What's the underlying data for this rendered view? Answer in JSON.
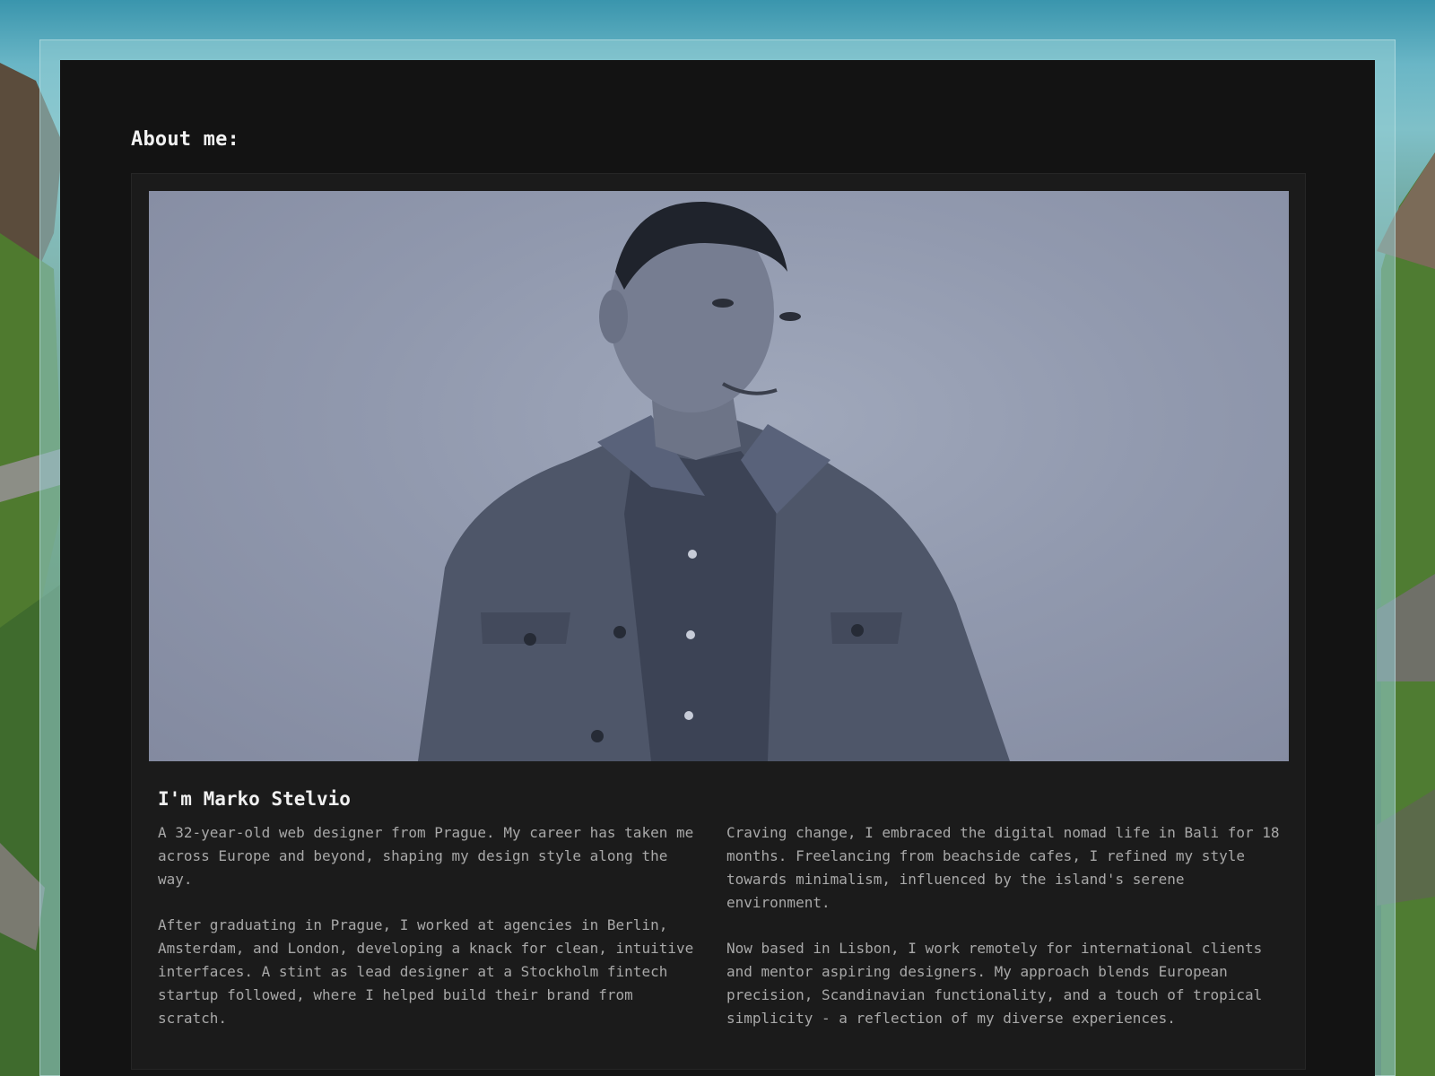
{
  "about": {
    "title": "About me:",
    "name": "I'm Marko Stelvio",
    "paragraphs_left": [
      "A 32-year-old web designer from Prague. My career has taken me across Europe and beyond, shaping my design style along the way.",
      "After graduating in Prague, I worked at agencies in Berlin, Amsterdam, and London, developing a knack for clean, intuitive interfaces. A stint as lead designer at a Stockholm fintech startup followed, where I helped build their brand from scratch."
    ],
    "paragraphs_right": [
      "Craving change, I embraced the digital nomad life in Bali for 18 months. Freelancing from beachside cafes, I refined my style towards minimalism, influenced by the island's serene environment.",
      "Now based in Lisbon, I work remotely for international clients and mentor aspiring designers. My approach blends European precision, Scandinavian functionality, and a touch of tropical simplicity - a reflection of my diverse experiences."
    ]
  },
  "colors": {
    "panel": "#131313",
    "card": "#1b1b1b",
    "heading": "#f2f2f2",
    "body_text": "#a8a8a8"
  }
}
